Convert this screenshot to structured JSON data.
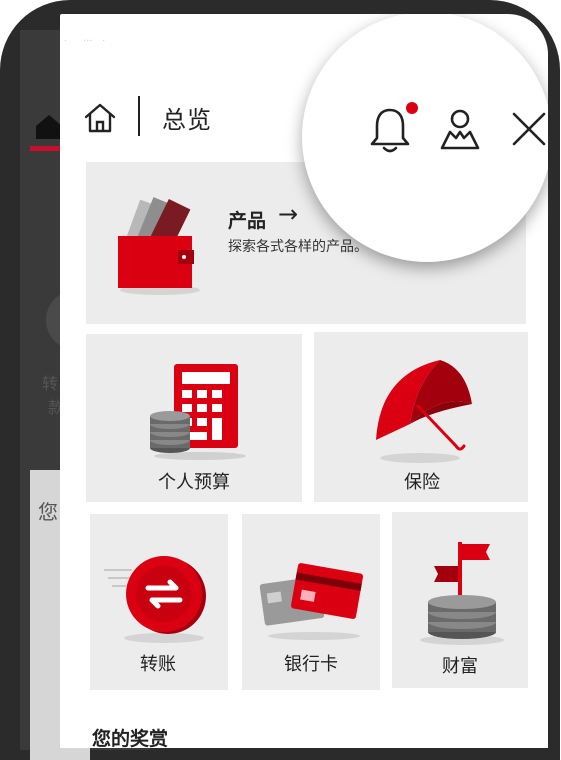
{
  "header": {
    "title": "总览"
  },
  "icons": {
    "home": "home-icon",
    "bell": "bell-icon",
    "user": "user-icon",
    "close": "close-icon"
  },
  "colors": {
    "accent": "#db0011",
    "tile_bg": "#ececec"
  },
  "products": {
    "title": "产品",
    "arrow": "→",
    "description": "探索各式各样的产品。"
  },
  "tiles": {
    "budget": "个人预算",
    "insurance": "保险",
    "transfer": "转账",
    "cards": "银行卡",
    "wealth": "财富"
  },
  "rewards": {
    "title": "您的奖赏"
  },
  "background": {
    "text1": "转",
    "text2": "款",
    "text3": "您"
  }
}
